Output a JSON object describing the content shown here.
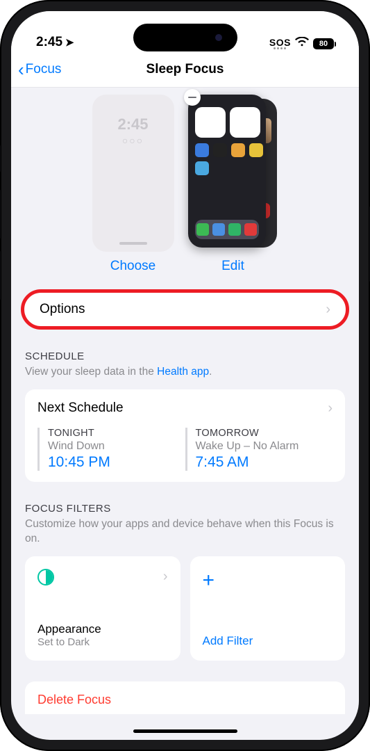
{
  "status": {
    "time": "2:45",
    "sos": "SOS",
    "battery": "80"
  },
  "nav": {
    "back": "Focus",
    "title": "Sleep Focus"
  },
  "screens": {
    "lock_time": "2:45",
    "lock_dots": "○○○",
    "choose": "Choose",
    "edit": "Edit"
  },
  "options": {
    "label": "Options"
  },
  "schedule": {
    "header": "SCHEDULE",
    "subtext_pre": "View your sleep data in the ",
    "link": "Health app",
    "subtext_post": ".",
    "card_title": "Next Schedule",
    "tonight": {
      "label": "TONIGHT",
      "sub": "Wind Down",
      "time": "10:45 PM"
    },
    "tomorrow": {
      "label": "TOMORROW",
      "sub": "Wake Up – No Alarm",
      "time": "7:45 AM"
    }
  },
  "filters": {
    "header": "FOCUS FILTERS",
    "subtext": "Customize how your apps and device behave when this Focus is on.",
    "appearance": {
      "name": "Appearance",
      "sub": "Set to Dark"
    },
    "add": "Add Filter"
  },
  "delete": {
    "label": "Delete Focus"
  }
}
